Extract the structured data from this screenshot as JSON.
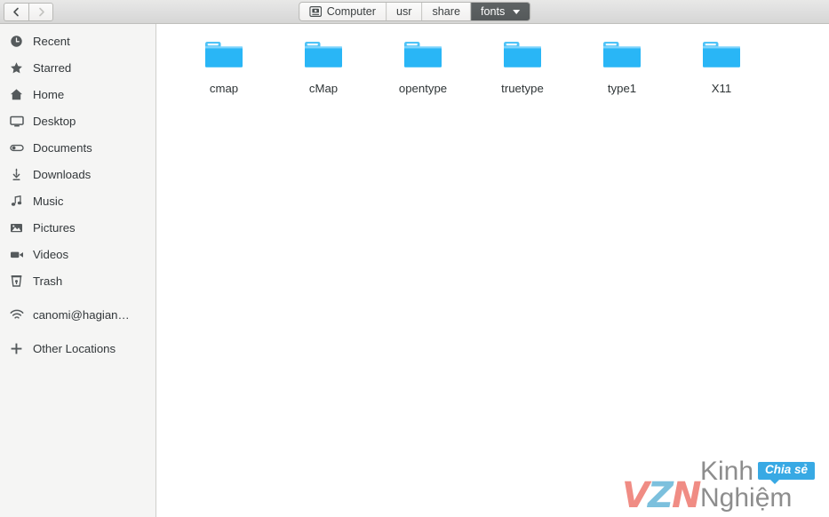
{
  "header": {
    "nav": {
      "back_label": "Back",
      "back_icon": "chevron-left-icon",
      "back_enabled": true,
      "forward_label": "Forward",
      "forward_icon": "chevron-right-icon",
      "forward_enabled": false
    },
    "path_breadcrumbs": [
      {
        "label": "Computer",
        "icon": "drive-icon",
        "active": false
      },
      {
        "label": "usr",
        "icon": "",
        "active": false
      },
      {
        "label": "share",
        "icon": "",
        "active": false
      },
      {
        "label": "fonts",
        "icon": "chevron-down-icon",
        "active": true
      }
    ]
  },
  "sidebar": {
    "items": [
      {
        "label": "Recent",
        "icon": "clock-icon",
        "gap": false
      },
      {
        "label": "Starred",
        "icon": "star-icon",
        "gap": false
      },
      {
        "label": "Home",
        "icon": "home-icon",
        "gap": false
      },
      {
        "label": "Desktop",
        "icon": "desktop-icon",
        "gap": false
      },
      {
        "label": "Documents",
        "icon": "documents-icon",
        "gap": false
      },
      {
        "label": "Downloads",
        "icon": "download-icon",
        "gap": false
      },
      {
        "label": "Music",
        "icon": "music-note-icon",
        "gap": false
      },
      {
        "label": "Pictures",
        "icon": "image-icon",
        "gap": false
      },
      {
        "label": "Videos",
        "icon": "video-camera-icon",
        "gap": false
      },
      {
        "label": "Trash",
        "icon": "trash-icon",
        "gap": false
      },
      {
        "label": "canomi@hagian…",
        "icon": "network-wifi-icon",
        "gap": true
      },
      {
        "label": "Other Locations",
        "icon": "plus-icon",
        "gap": true
      }
    ]
  },
  "main": {
    "files": [
      {
        "name": "cmap",
        "icon": "folder-icon"
      },
      {
        "name": "cMap",
        "icon": "folder-icon"
      },
      {
        "name": "opentype",
        "icon": "folder-icon"
      },
      {
        "name": "truetype",
        "icon": "folder-icon"
      },
      {
        "name": "type1",
        "icon": "folder-icon"
      },
      {
        "name": "X11",
        "icon": "folder-icon"
      }
    ]
  },
  "watermark": {
    "logo_v": "V",
    "logo_z": "Z",
    "logo_n": "N",
    "text": "Kinh Nghiệm",
    "badge": "Chia sẻ"
  },
  "colors": {
    "folder_body": "#29b6f6",
    "folder_tab": "#4fc3f7",
    "accent_blue": "#38a9e4",
    "sidebar_bg": "#f5f5f4",
    "header_bg": "#dedede",
    "active_crumb": "#595e5f",
    "logo_salmon": "#f08c84",
    "logo_blue": "#7cc0dd"
  }
}
